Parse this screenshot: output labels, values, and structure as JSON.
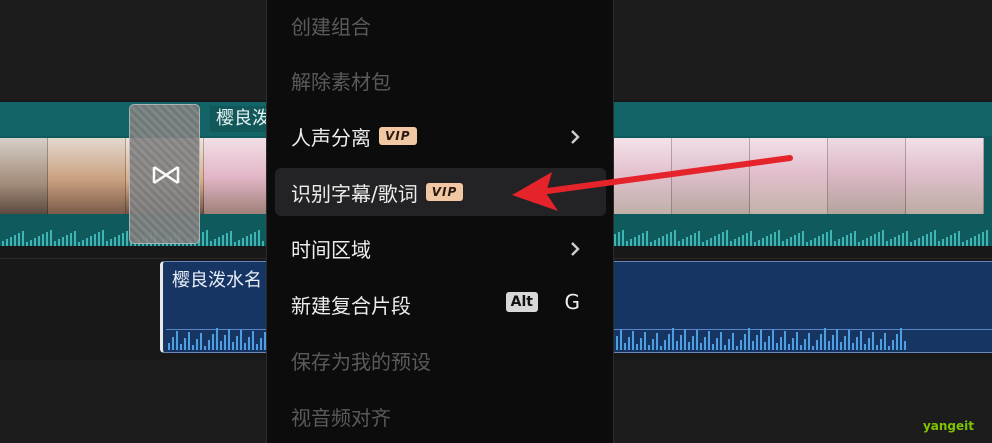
{
  "video_track": {
    "clip_title": "樱良泼"
  },
  "audio_track": {
    "clip_title": "樱良泼水名"
  },
  "context_menu": {
    "items": [
      {
        "label": "创建组合",
        "disabled": true
      },
      {
        "label": "解除素材包",
        "disabled": true
      },
      {
        "label": "人声分离",
        "badge": "VIP",
        "submenu": true
      },
      {
        "label": "识别字幕/歌词",
        "badge": "VIP",
        "highlighted": true
      },
      {
        "label": "时间区域",
        "submenu": true
      },
      {
        "label": "新建复合片段",
        "shortcut_modifier": "Alt",
        "shortcut_key": "G"
      },
      {
        "label": "保存为我的预设",
        "disabled": true
      },
      {
        "label": "视音频对齐",
        "disabled": true
      }
    ]
  },
  "colors": {
    "video_track": "#0f5a5c",
    "audio_track": "#163563",
    "vip_badge": "#f2c8a4",
    "arrow": "#e5232b"
  },
  "icons": {
    "transition": "bowtie-transition-icon",
    "submenu": "chevron-right-icon"
  },
  "watermark": "yangeit"
}
